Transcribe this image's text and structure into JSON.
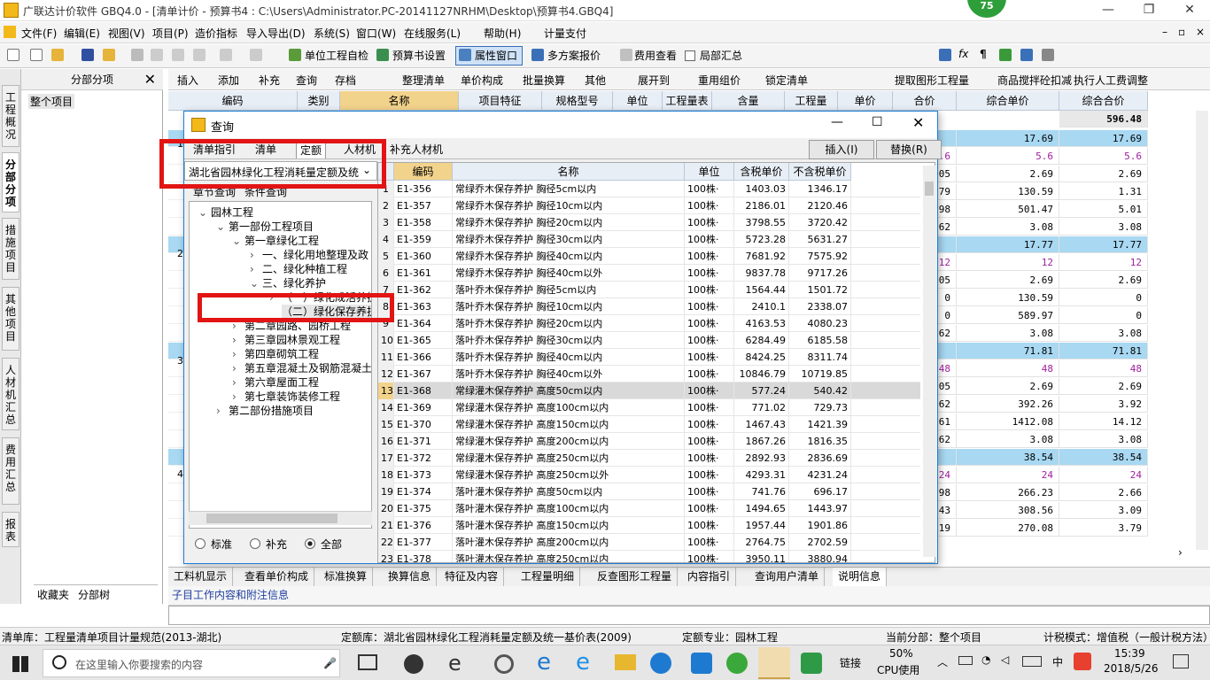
{
  "window": {
    "title": "广联达计价软件 GBQ4.0 - [清单计价 - 预算书4 : C:\\Users\\Administrator.PC-20141127NRHM\\Desktop\\预算书4.GBQ4]",
    "badge": "75"
  },
  "menu": [
    "文件(F)",
    "编辑(E)",
    "视图(V)",
    "项目(P)",
    "造价指标",
    "导入导出(D)",
    "系统(S)",
    "窗口(W)",
    "在线服务(L)",
    "帮助(H)",
    "计量支付"
  ],
  "toolbar1": [
    "单位工程自检",
    "预算书设置",
    "属性窗口",
    "多方案报价",
    "费用查看",
    "局部汇总"
  ],
  "toolbar2": [
    "插入",
    "添加",
    "补充",
    "查询",
    "存档",
    "整理清单",
    "单价构成",
    "批量换算",
    "其他",
    "展开到",
    "重用组价",
    "锁定清单",
    "提取图形工程量",
    "商品搅拌砼扣减",
    "执行人工费调整"
  ],
  "left_panel": {
    "header": "分部分项",
    "item": "整个项目",
    "tabs": [
      "收藏夹",
      "分部树"
    ]
  },
  "vtabs": [
    "工程概况",
    "分部分项",
    "措施项目",
    "其他项目",
    "人材机汇总",
    "费用汇总",
    "报表"
  ],
  "grid": {
    "columns": [
      "编码",
      "类别",
      "名称",
      "项目特征",
      "规格型号",
      "单位",
      "工程量表达式",
      "含量",
      "工程量",
      "单价",
      "合价",
      "综合单价",
      "综合合价"
    ],
    "total": "596.48",
    "row_markers": [
      "1",
      "2",
      "3",
      "4"
    ],
    "rows": [
      [
        "",
        "17.69",
        "17.69"
      ],
      [
        "5.6",
        "5.6",
        "5.6"
      ],
      [
        "4.05",
        "2.69",
        "2.69"
      ],
      [
        "1.79",
        "130.59",
        "1.31"
      ],
      [
        "5.98",
        "501.47",
        "5.01"
      ],
      [
        "3.62",
        "3.08",
        "3.08"
      ],
      [
        "",
        "17.77",
        "17.77"
      ],
      [
        "12",
        "12",
        "12"
      ],
      [
        "4.05",
        "2.69",
        "2.69"
      ],
      [
        "0",
        "130.59",
        "0"
      ],
      [
        "0",
        "589.97",
        "0"
      ],
      [
        "3.62",
        "3.08",
        "3.08"
      ],
      [
        "",
        "71.81",
        "71.81"
      ],
      [
        "48",
        "48",
        "48"
      ],
      [
        "4.05",
        "2.69",
        "2.69"
      ],
      [
        "5.62",
        "392.26",
        "3.92"
      ],
      [
        "18.61",
        "1412.08",
        "14.12"
      ],
      [
        "3.62",
        "3.08",
        "3.08"
      ],
      [
        "",
        "38.54",
        "38.54"
      ],
      [
        "24",
        "24",
        "24"
      ],
      [
        "3.98",
        "266.23",
        "2.66"
      ],
      [
        "4.43",
        "308.56",
        "3.09"
      ],
      [
        "14.19",
        "270.08",
        "3.79"
      ]
    ]
  },
  "bottom_tabs": [
    "工料机显示",
    "查看单价构成",
    "标准换算",
    "换算信息",
    "特征及内容",
    "工程量明细",
    "反查图形工程量",
    "内容指引",
    "查询用户清单",
    "说明信息"
  ],
  "info_title": "子目工作内容和附注信息",
  "status": {
    "qingdan": "清单库：工程量清单项目计量规范(2013-湖北)",
    "dinge": "定额库：湖北省园林绿化工程消耗量定额及统一基价表(2009)",
    "zhuanye": "定额专业：园林工程",
    "fenbu": "当前分部：整个项目",
    "mode": "计税模式：增值税（一般计税方法）"
  },
  "taskbar": {
    "search": "在这里输入你要搜索的内容",
    "cpu": "50%",
    "cpu_label": "CPU使用",
    "link": "链接",
    "ime": "中",
    "time": "15:39",
    "date": "2018/5/26"
  },
  "dialog": {
    "title": "查询",
    "tabs": [
      "清单指引",
      "清单",
      "定额",
      "人材机",
      "补充人材机"
    ],
    "library": "湖北省园林绿化工程消耗量定额及统",
    "subtabs": [
      "章节查询",
      "条件查询"
    ],
    "insert": "插入(I)",
    "replace": "替换(R)",
    "radios": [
      "标准",
      "补充",
      "全部"
    ],
    "tree": [
      "园林工程",
      "第一部份工程项目",
      "第一章绿化工程",
      "一、绿化用地整理及政",
      "二、绿化种植工程",
      "三、绿化养护",
      "（一）绿化成活养护",
      "（二）绿化保存养护",
      "第二章园路、园桥工程",
      "第三章园林景观工程",
      "第四章砌筑工程",
      "第五章混凝土及钢筋混凝土",
      "第六章屋面工程",
      "第七章装饰装修工程",
      "第二部份措施项目"
    ],
    "columns": [
      "编码",
      "名称",
      "单位",
      "含税单价",
      "不含税单价"
    ],
    "rows": [
      [
        "1",
        "E1-356",
        "常绿乔木保存养护 胸径5cm以内",
        "100株·",
        "1403.03",
        "1346.17"
      ],
      [
        "2",
        "E1-357",
        "常绿乔木保存养护 胸径10cm以内",
        "100株·",
        "2186.01",
        "2120.46"
      ],
      [
        "3",
        "E1-358",
        "常绿乔木保存养护 胸径20cm以内",
        "100株·",
        "3798.55",
        "3720.42"
      ],
      [
        "4",
        "E1-359",
        "常绿乔木保存养护 胸径30cm以内",
        "100株·",
        "5723.28",
        "5631.27"
      ],
      [
        "5",
        "E1-360",
        "常绿乔木保存养护 胸径40cm以内",
        "100株·",
        "7681.92",
        "7575.92"
      ],
      [
        "6",
        "E1-361",
        "常绿乔木保存养护 胸径40cm以外",
        "100株·",
        "9837.78",
        "9717.26"
      ],
      [
        "7",
        "E1-362",
        "落叶乔木保存养护 胸径5cm以内",
        "100株·",
        "1564.44",
        "1501.72"
      ],
      [
        "8",
        "E1-363",
        "落叶乔木保存养护 胸径10cm以内",
        "100株·",
        "2410.1",
        "2338.07"
      ],
      [
        "9",
        "E1-364",
        "落叶乔木保存养护 胸径20cm以内",
        "100株·",
        "4163.53",
        "4080.23"
      ],
      [
        "10",
        "E1-365",
        "落叶乔木保存养护 胸径30cm以内",
        "100株·",
        "6284.49",
        "6185.58"
      ],
      [
        "11",
        "E1-366",
        "落叶乔木保存养护 胸径40cm以内",
        "100株·",
        "8424.25",
        "8311.74"
      ],
      [
        "12",
        "E1-367",
        "落叶乔木保存养护 胸径40cm以外",
        "100株·",
        "10846.79",
        "10719.85"
      ],
      [
        "13",
        "E1-368",
        "常绿灌木保存养护 高度50cm以内",
        "100株·",
        "577.24",
        "540.42"
      ],
      [
        "14",
        "E1-369",
        "常绿灌木保存养护 高度100cm以内",
        "100株·",
        "771.02",
        "729.73"
      ],
      [
        "15",
        "E1-370",
        "常绿灌木保存养护 高度150cm以内",
        "100株·",
        "1467.43",
        "1421.39"
      ],
      [
        "16",
        "E1-371",
        "常绿灌木保存养护 高度200cm以内",
        "100株·",
        "1867.26",
        "1816.35"
      ],
      [
        "17",
        "E1-372",
        "常绿灌木保存养护 高度250cm以内",
        "100株·",
        "2892.93",
        "2836.69"
      ],
      [
        "18",
        "E1-373",
        "常绿灌木保存养护 高度250cm以外",
        "100株·",
        "4293.31",
        "4231.24"
      ],
      [
        "19",
        "E1-374",
        "落叶灌木保存养护 高度50cm以内",
        "100株·",
        "741.76",
        "696.17"
      ],
      [
        "20",
        "E1-375",
        "落叶灌木保存养护 高度100cm以内",
        "100株·",
        "1494.65",
        "1443.97"
      ],
      [
        "21",
        "E1-376",
        "落叶灌木保存养护 高度150cm以内",
        "100株·",
        "1957.44",
        "1901.86"
      ],
      [
        "22",
        "E1-377",
        "落叶灌木保存养护 高度200cm以内",
        "100株·",
        "2764.75",
        "2702.59"
      ],
      [
        "23",
        "E1-378",
        "落叶灌木保存养护 高度250cm以内",
        "100株·",
        "3950.11",
        "3880.94"
      ]
    ]
  }
}
